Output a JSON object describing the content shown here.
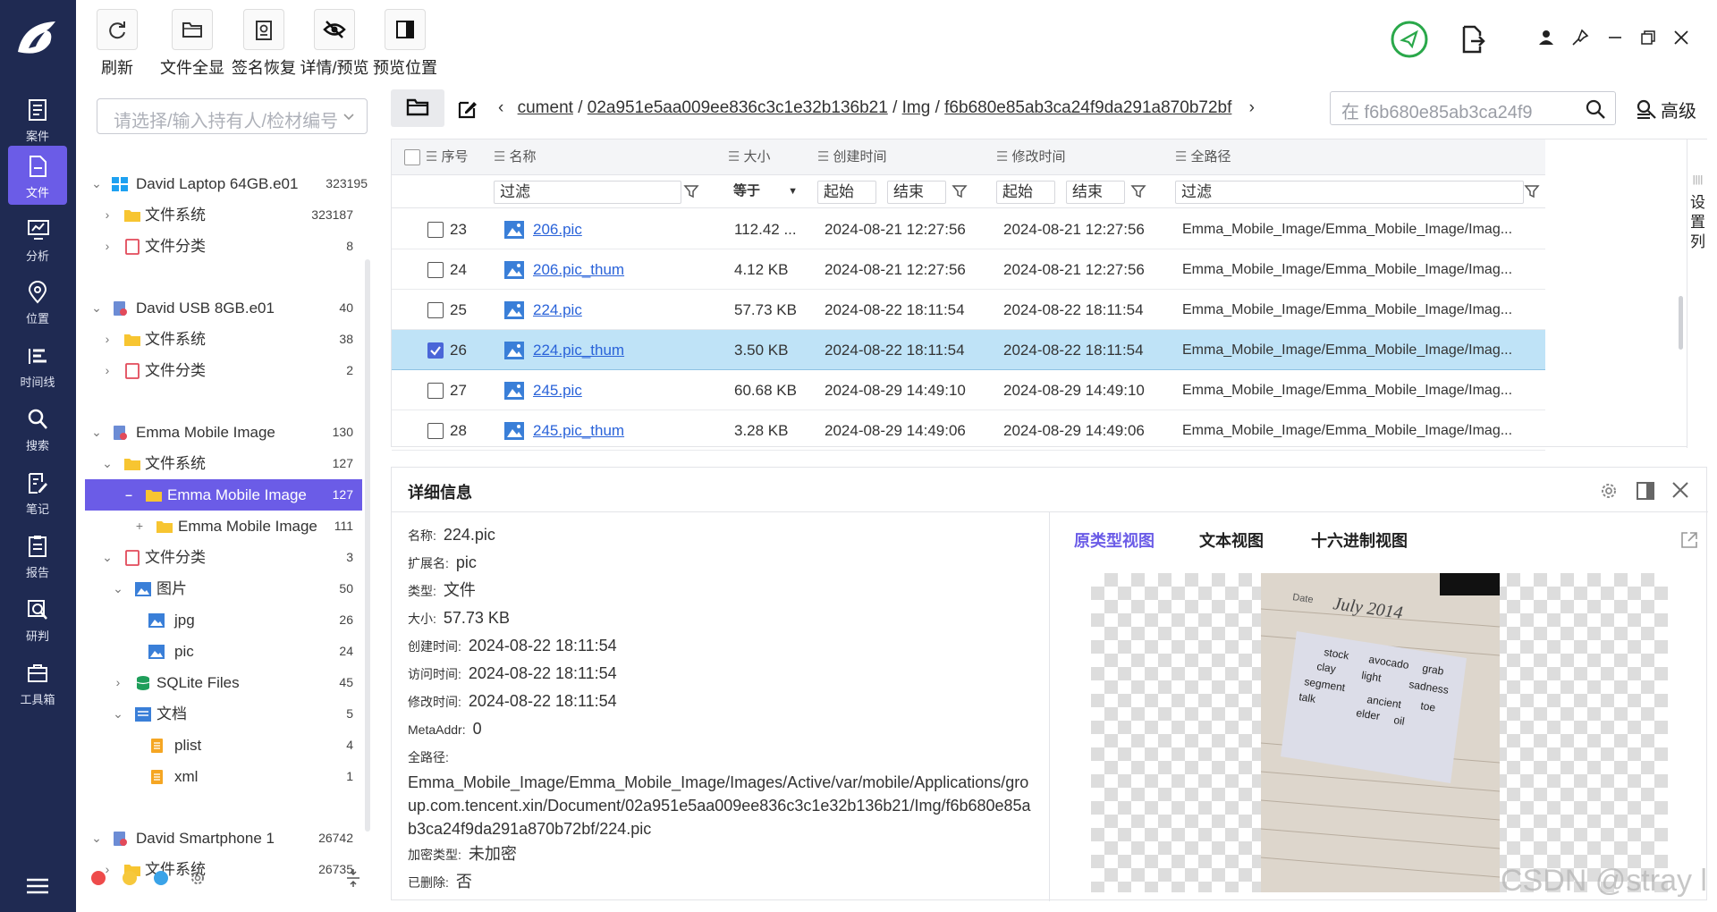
{
  "nav": {
    "items": [
      {
        "label": "案件",
        "icon": "case-icon"
      },
      {
        "label": "文件",
        "icon": "file-icon"
      },
      {
        "label": "分析",
        "icon": "analysis-icon"
      },
      {
        "label": "位置",
        "icon": "location-pin-icon"
      },
      {
        "label": "时间线",
        "icon": "timeline-icon"
      },
      {
        "label": "搜索",
        "icon": "search-icon"
      },
      {
        "label": "笔记",
        "icon": "notes-icon"
      },
      {
        "label": "报告",
        "icon": "report-icon"
      },
      {
        "label": "研判",
        "icon": "research-icon"
      },
      {
        "label": "工具箱",
        "icon": "toolbox-icon"
      }
    ],
    "active": "文件",
    "accent": "#6b5ce7",
    "background": "#1f2a52"
  },
  "toolbar": {
    "buttons": [
      {
        "label": "刷新",
        "icon": "refresh-icon"
      },
      {
        "label": "文件全显",
        "icon": "folder-icon"
      },
      {
        "label": "签名恢复",
        "icon": "signature-recover-icon"
      },
      {
        "label": "详情/预览",
        "icon": "eye-slash-icon"
      },
      {
        "label": "预览位置",
        "icon": "panel-position-icon"
      }
    ]
  },
  "tree": {
    "owner_placeholder": "请选择/输入持有人/检材编号",
    "nodes": [
      {
        "label": "David Laptop 64GB.e01",
        "count": "323195"
      },
      {
        "label": "文件系统",
        "count": "323187"
      },
      {
        "label": "文件分类",
        "count": "8"
      },
      {
        "label": "David USB 8GB.e01",
        "count": "40"
      },
      {
        "label": "文件系统",
        "count": "38"
      },
      {
        "label": "文件分类",
        "count": "2"
      },
      {
        "label": "Emma Mobile Image",
        "count": "130"
      },
      {
        "label": "文件系统",
        "count": "127"
      },
      {
        "label": "Emma Mobile Image",
        "count": "127"
      },
      {
        "label": "Emma Mobile Image",
        "count": "111"
      },
      {
        "label": "文件分类",
        "count": "3"
      },
      {
        "label": "图片",
        "count": "50"
      },
      {
        "label": "jpg",
        "count": "26"
      },
      {
        "label": "pic",
        "count": "24"
      },
      {
        "label": "SQLite Files",
        "count": "45"
      },
      {
        "label": "文档",
        "count": "5"
      },
      {
        "label": "plist",
        "count": "4"
      },
      {
        "label": "xml",
        "count": "1"
      },
      {
        "label": "David Smartphone 1",
        "count": "26742"
      },
      {
        "label": "文件系统",
        "count": "26735"
      }
    ]
  },
  "path": {
    "crumbs": [
      "cument",
      "02a951e5aa009ee836c3c1e32b136b21",
      "Img",
      "f6b680e85ab3ca24f9da291a870b72bf"
    ],
    "search_placeholder": "在 f6b680e85ab3ca24f9",
    "advanced_label": "高级"
  },
  "table": {
    "headers": [
      "序号",
      "名称",
      "大小",
      "创建时间",
      "修改时间",
      "全路径"
    ],
    "filters": {
      "name": "过滤",
      "size_op": "等于",
      "start": "起始",
      "end": "结束",
      "path": "过滤"
    },
    "rows": [
      {
        "no": "23",
        "name": "206.pic",
        "size": "112.42 ...",
        "created": "2024-08-21 12:27:56",
        "modified": "2024-08-21 12:27:56",
        "path": "Emma_Mobile_Image/Emma_Mobile_Image/Imag...",
        "checked": false
      },
      {
        "no": "24",
        "name": "206.pic_thum",
        "size": "4.12 KB",
        "created": "2024-08-21 12:27:56",
        "modified": "2024-08-21 12:27:56",
        "path": "Emma_Mobile_Image/Emma_Mobile_Image/Imag...",
        "checked": false
      },
      {
        "no": "25",
        "name": "224.pic",
        "size": "57.73 KB",
        "created": "2024-08-22 18:11:54",
        "modified": "2024-08-22 18:11:54",
        "path": "Emma_Mobile_Image/Emma_Mobile_Image/Imag...",
        "checked": false
      },
      {
        "no": "26",
        "name": "224.pic_thum",
        "size": "3.50 KB",
        "created": "2024-08-22 18:11:54",
        "modified": "2024-08-22 18:11:54",
        "path": "Emma_Mobile_Image/Emma_Mobile_Image/Imag...",
        "checked": true
      },
      {
        "no": "27",
        "name": "245.pic",
        "size": "60.68 KB",
        "created": "2024-08-29 14:49:10",
        "modified": "2024-08-29 14:49:10",
        "path": "Emma_Mobile_Image/Emma_Mobile_Image/Imag...",
        "checked": false
      },
      {
        "no": "28",
        "name": "245.pic_thum",
        "size": "3.28 KB",
        "created": "2024-08-29 14:49:06",
        "modified": "2024-08-29 14:49:06",
        "path": "Emma_Mobile_Image/Emma_Mobile_Image/Imag...",
        "checked": false
      }
    ],
    "set_columns_label": "设置列",
    "highlight_color": "#bfe3f7"
  },
  "details": {
    "title": "详细信息",
    "props": {
      "name_k": "名称:",
      "name_v": "224.pic",
      "ext_k": "扩展名:",
      "ext_v": "pic",
      "type_k": "类型:",
      "type_v": "文件",
      "size_k": "大小:",
      "size_v": "57.73 KB",
      "created_k": "创建时间:",
      "created_v": "2024-08-22 18:11:54",
      "accessed_k": "访问时间:",
      "accessed_v": "2024-08-22 18:11:54",
      "modified_k": "修改时间:",
      "modified_v": "2024-08-22 18:11:54",
      "meta_k": "MetaAddr:",
      "meta_v": "0",
      "path_k": "全路径:",
      "path_v": "Emma_Mobile_Image/Emma_Mobile_Image/Images/Active/var/mobile/Applications/group.com.tencent.xin/Document/02a951e5aa009ee836c3c1e32b136b21/Img/f6b680e85ab3ca24f9da291a870b72bf/224.pic",
      "enc_k": "加密类型:",
      "enc_v": "未加密",
      "del_k": "已删除:",
      "del_v": "否"
    },
    "tabs": [
      "原类型视图",
      "文本视图",
      "十六进制视图"
    ],
    "active_tab_color": "#6b5ce7",
    "photo_text": {
      "date_label": "Date",
      "date_value": "July 2014",
      "words": [
        "stock",
        "avocado",
        "grab",
        "clay",
        "light",
        "sadness",
        "segment",
        "ancient",
        "toe",
        "talk",
        "elder",
        "oil"
      ]
    }
  },
  "watermark": "CSDN @stray l"
}
